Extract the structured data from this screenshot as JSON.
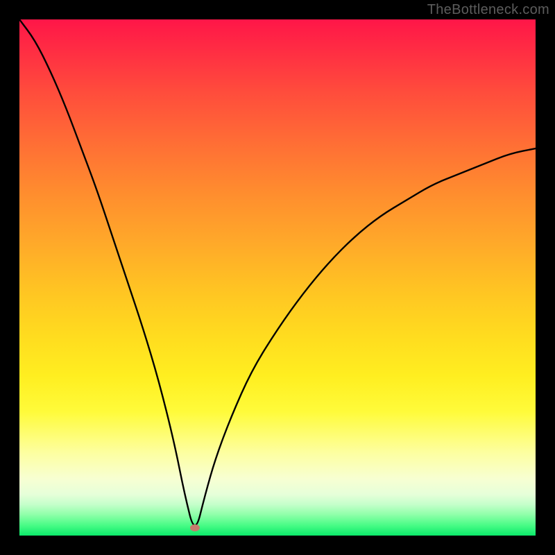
{
  "watermark": "TheBottleneck.com",
  "chart_data": {
    "type": "line",
    "title": "",
    "xlabel": "",
    "ylabel": "",
    "xlim": [
      0,
      100
    ],
    "ylim": [
      0,
      100
    ],
    "marker": {
      "x": 34,
      "y": 1.5,
      "color": "#c77b6c",
      "rx": 7,
      "ry": 5
    },
    "curve": {
      "description": "V-shaped bottleneck curve starting near 100 at x=0, reaching minimum ~0 near x=34, rising concavely toward ~75 at x=100",
      "points": [
        {
          "x": 0,
          "y": 100
        },
        {
          "x": 3,
          "y": 96
        },
        {
          "x": 6,
          "y": 90
        },
        {
          "x": 9,
          "y": 83
        },
        {
          "x": 12,
          "y": 75
        },
        {
          "x": 15,
          "y": 67
        },
        {
          "x": 18,
          "y": 58
        },
        {
          "x": 21,
          "y": 49
        },
        {
          "x": 24,
          "y": 40
        },
        {
          "x": 27,
          "y": 30
        },
        {
          "x": 30,
          "y": 18
        },
        {
          "x": 32,
          "y": 8
        },
        {
          "x": 34,
          "y": 0
        },
        {
          "x": 36,
          "y": 8
        },
        {
          "x": 38,
          "y": 15
        },
        {
          "x": 41,
          "y": 23
        },
        {
          "x": 45,
          "y": 32
        },
        {
          "x": 50,
          "y": 40
        },
        {
          "x": 55,
          "y": 47
        },
        {
          "x": 60,
          "y": 53
        },
        {
          "x": 65,
          "y": 58
        },
        {
          "x": 70,
          "y": 62
        },
        {
          "x": 75,
          "y": 65
        },
        {
          "x": 80,
          "y": 68
        },
        {
          "x": 85,
          "y": 70
        },
        {
          "x": 90,
          "y": 72
        },
        {
          "x": 95,
          "y": 74
        },
        {
          "x": 100,
          "y": 75
        }
      ]
    }
  }
}
